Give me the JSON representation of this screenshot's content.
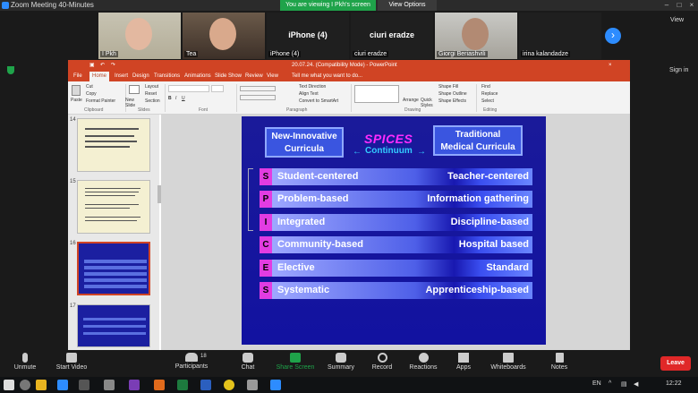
{
  "window": {
    "title": "Zoom Meeting 40-Minutes"
  },
  "share_banner": "You are viewing I Pkh's screen",
  "view_options": "View Options",
  "gallery": [
    {
      "name": "I Pkh"
    },
    {
      "name": "Tea"
    },
    {
      "name": "iPhone (4)",
      "big": "iPhone (4)"
    },
    {
      "name": "ciuri eradze",
      "big": "ciuri eradze"
    },
    {
      "name": "Giorgi Beriashvili"
    },
    {
      "name": "irina kalandadze"
    }
  ],
  "view_label": "View",
  "sign_in": "Sign in",
  "ppt": {
    "doc_title": "20.07.24. (Compatibility Mode) - PowerPoint",
    "tell_me": "Tell me what you want to do...",
    "tabs": [
      "File",
      "Home",
      "Insert",
      "Design",
      "Transitions",
      "Animations",
      "Slide Show",
      "Review",
      "View"
    ],
    "ribbon": {
      "paste": "Paste",
      "cut": "Cut",
      "copy": "Copy",
      "format_painter": "Format Painter",
      "clipboard": "Clipboard",
      "new_slide": "New Slide",
      "layout": "Layout",
      "reset": "Reset",
      "section": "Section",
      "slides": "Slides",
      "font": "Font",
      "paragraph": "Paragraph",
      "text_direction": "Text Direction",
      "align_text": "Align Text",
      "convert_smartart": "Convert to SmartArt",
      "arrange": "Arrange",
      "quick_styles": "Quick Styles",
      "drawing": "Drawing",
      "shape_fill": "Shape Fill",
      "shape_outline": "Shape Outline",
      "shape_effects": "Shape Effects",
      "find": "Find",
      "replace": "Replace",
      "select": "Select",
      "editing": "Editing"
    },
    "slide_numbers": [
      "14",
      "15",
      "16",
      "17"
    ]
  },
  "slide": {
    "left_header": [
      "New-Innovative",
      "Curricula"
    ],
    "right_header": [
      "Traditional",
      "Medical Curricula"
    ],
    "center": "SPICES",
    "continuum": "Continuum",
    "rows": [
      {
        "letter": "S",
        "left": "Student-centered",
        "right": "Teacher-centered"
      },
      {
        "letter": "P",
        "left": "Problem-based",
        "right": "Information gathering"
      },
      {
        "letter": "I",
        "left": "Integrated",
        "right": "Discipline-based"
      },
      {
        "letter": "C",
        "left": "Community-based",
        "right": "Hospital based"
      },
      {
        "letter": "E",
        "left": "Elective",
        "right": "Standard"
      },
      {
        "letter": "S",
        "left": "Systematic",
        "right": "Apprenticeship-based"
      }
    ]
  },
  "toolbar": {
    "unmute": "Unmute",
    "start_video": "Start Video",
    "participants": "Participants",
    "participants_count": "18",
    "chat": "Chat",
    "share_screen": "Share Screen",
    "summary": "Summary",
    "record": "Record",
    "reactions": "Reactions",
    "apps": "Apps",
    "whiteboards": "Whiteboards",
    "notes": "Notes",
    "leave": "Leave"
  },
  "taskbar": {
    "lang": "EN",
    "time": "12:22"
  }
}
